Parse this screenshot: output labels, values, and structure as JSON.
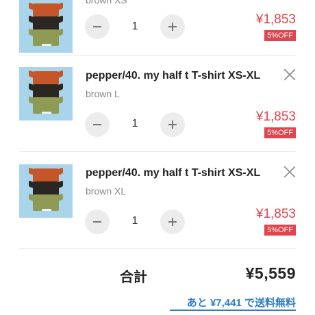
{
  "items": [
    {
      "title": "",
      "variant": "brown XS",
      "quantity": "1",
      "price": "¥1,853",
      "discount": "5%OFF"
    },
    {
      "title": "pepper/40. my half t T-shirt XS-XL",
      "variant": "brown L",
      "quantity": "1",
      "price": "¥1,853",
      "discount": "5%OFF"
    },
    {
      "title": "pepper/40. my half t T-shirt XS-XL",
      "variant": "brown XL",
      "quantity": "1",
      "price": "¥1,853",
      "discount": "5%OFF"
    }
  ],
  "summary": {
    "total_label": "合計",
    "total_value": "¥5,559",
    "free_shipping_text": "あと ¥7,441 で送料無料"
  },
  "colors": {
    "price": "#e0444c",
    "discount_badge": "#e0444c",
    "link": "#2f7dc4",
    "thumbnail_bg": "#a9d5ec"
  },
  "icons": {
    "remove": "close-icon",
    "decrease": "minus-icon",
    "increase": "plus-icon"
  }
}
